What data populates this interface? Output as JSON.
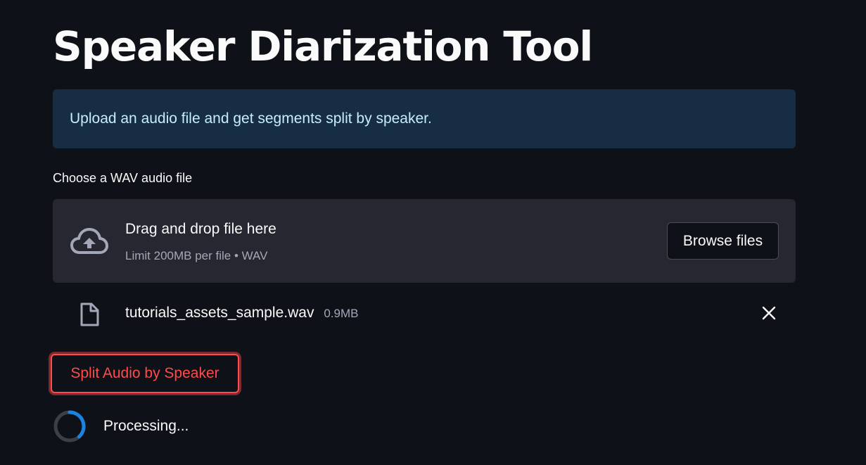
{
  "page": {
    "title": "Speaker Diarization Tool",
    "info_message": "Upload an audio file and get segments split by speaker."
  },
  "uploader": {
    "label": "Choose a WAV audio file",
    "dropzone_title": "Drag and drop file here",
    "dropzone_limit": "Limit 200MB per file • WAV",
    "browse_label": "Browse files",
    "icon": "cloud-upload-icon"
  },
  "uploaded_file": {
    "name": "tutorials_assets_sample.wav",
    "size": "0.9MB",
    "icon": "file-icon",
    "remove_icon": "close-icon"
  },
  "actions": {
    "split_label": "Split Audio by Speaker"
  },
  "status": {
    "text": "Processing...",
    "icon": "spinner-icon"
  },
  "colors": {
    "background": "#0e1117",
    "info_background": "#172d43",
    "info_text": "#c7ebff",
    "dropzone_background": "#262730",
    "primary": "#ff4b4b",
    "spinner_accent": "#1c83e1"
  }
}
